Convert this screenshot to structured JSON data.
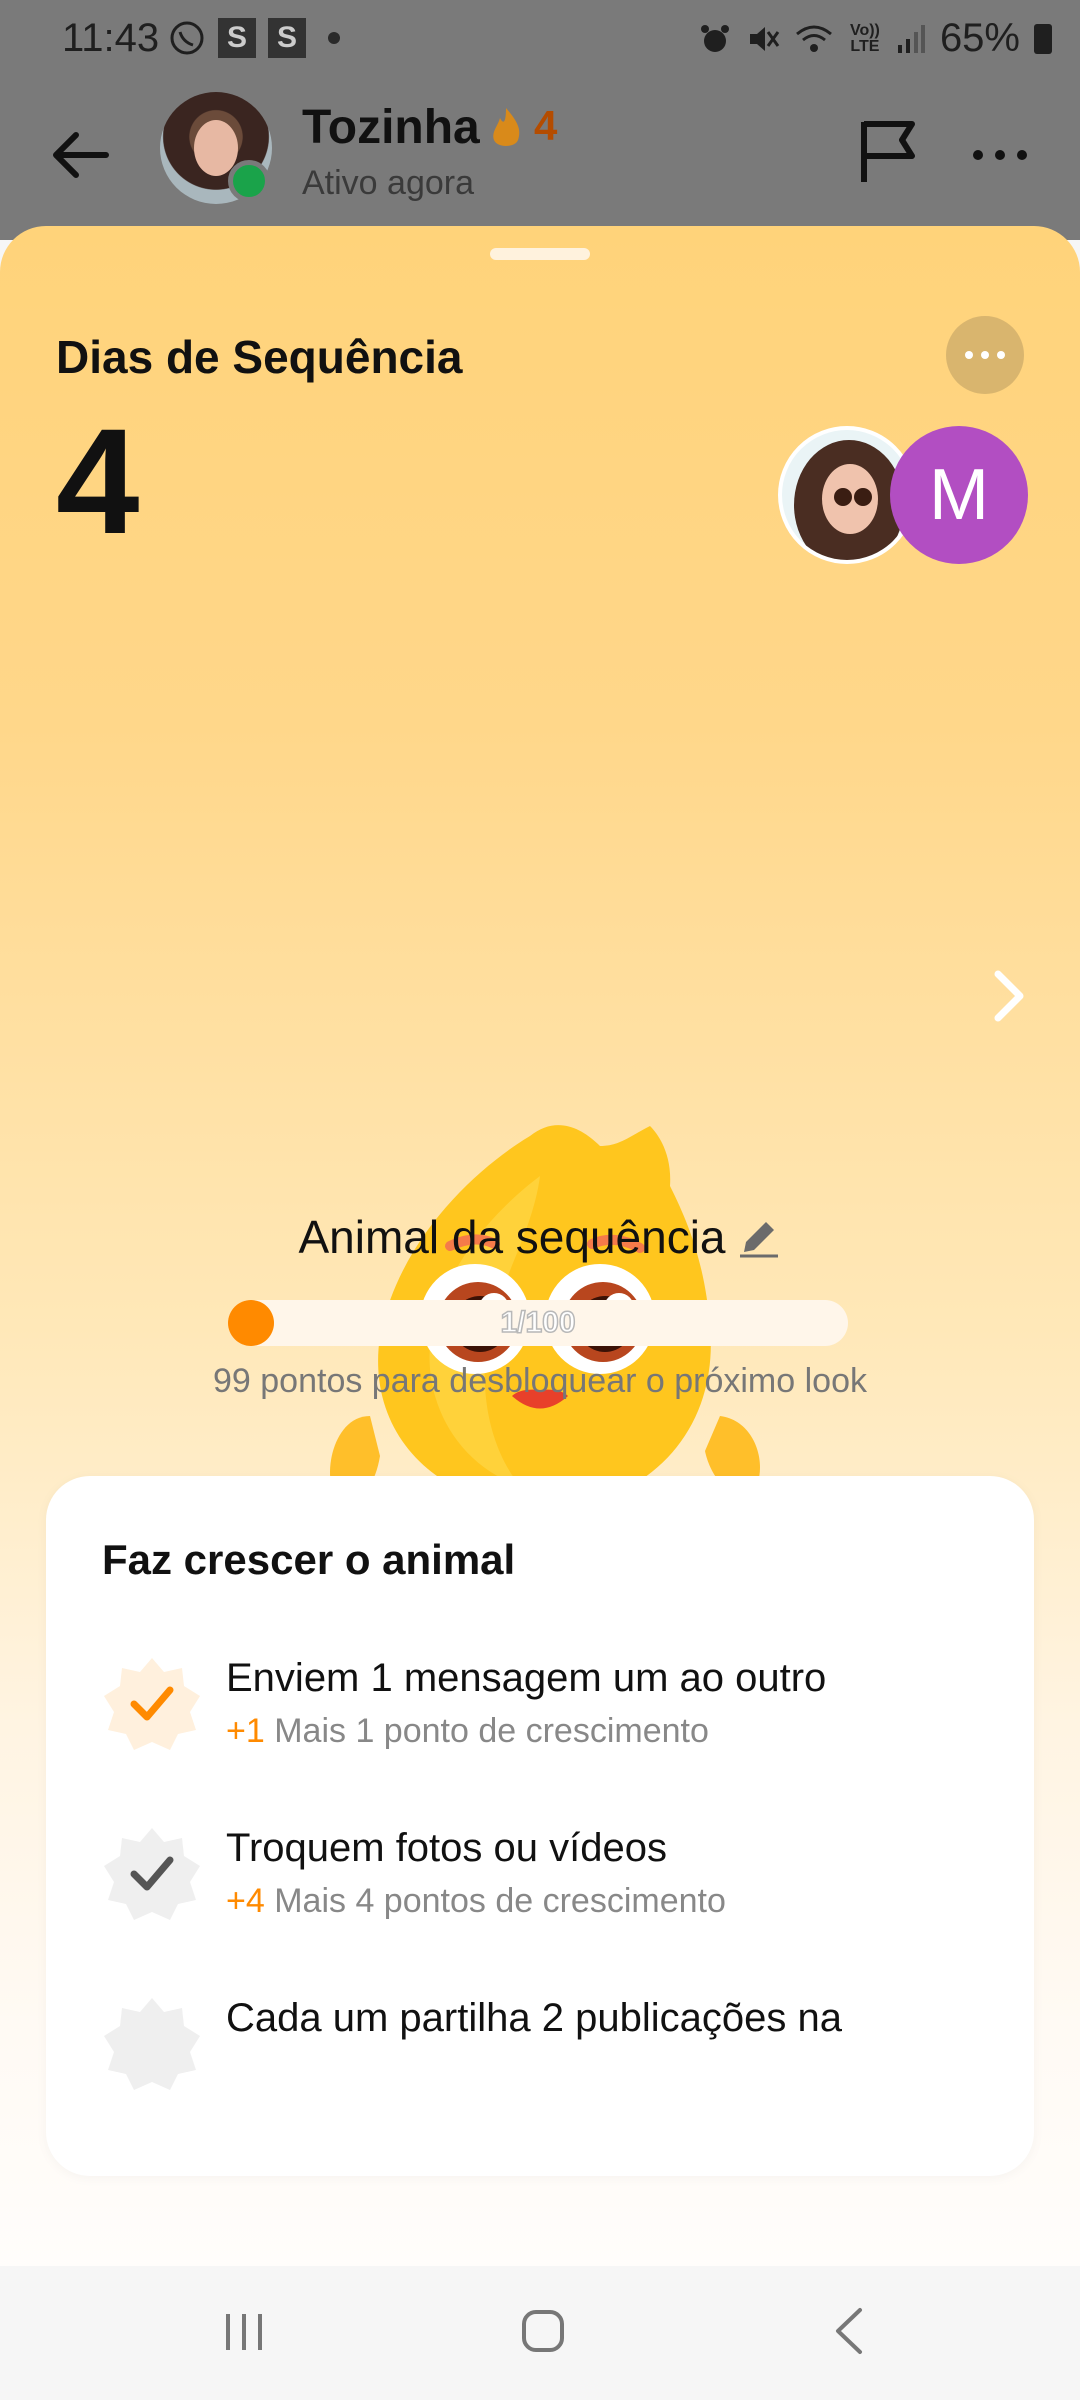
{
  "status_bar": {
    "time": "11:43",
    "left_boxes": [
      "S",
      "S"
    ],
    "volte": "Vo)) LTE",
    "battery": "65%"
  },
  "chat_header": {
    "contact_name": "Tozinha",
    "streak": "4",
    "status": "Ativo agora"
  },
  "sheet": {
    "title": "Dias de Sequência",
    "streak_days": "4",
    "partner_initial": "M",
    "animal_label": "Animal da sequência",
    "progress": {
      "label": "1/100",
      "current": 1,
      "max": 100
    },
    "unlock_text": "99 pontos para desbloquear o próximo look"
  },
  "grow_card": {
    "title": "Faz crescer o animal",
    "tasks": [
      {
        "title": "Enviem 1 mensagem um ao outro",
        "points": "+1",
        "desc": "Mais 1 ponto de crescimento",
        "done": true
      },
      {
        "title": "Troquem fotos ou vídeos",
        "points": "+4",
        "desc": "Mais 4 pontos de crescimento",
        "done": false
      },
      {
        "title": "Cada um partilha 2 publicações na",
        "points": "",
        "desc": "",
        "done": false
      }
    ]
  },
  "colors": {
    "accent": "#ff8a00",
    "online": "#1aa34a",
    "partner_avatar": "#b24ec2",
    "sheet_top": "#ffd37a"
  },
  "icons": [
    "back-arrow-icon",
    "flame-icon",
    "flag-icon",
    "more-icon",
    "chevron-right-icon",
    "pencil-icon",
    "check-badge-icon",
    "recents-icon",
    "home-icon",
    "back-nav-icon"
  ]
}
